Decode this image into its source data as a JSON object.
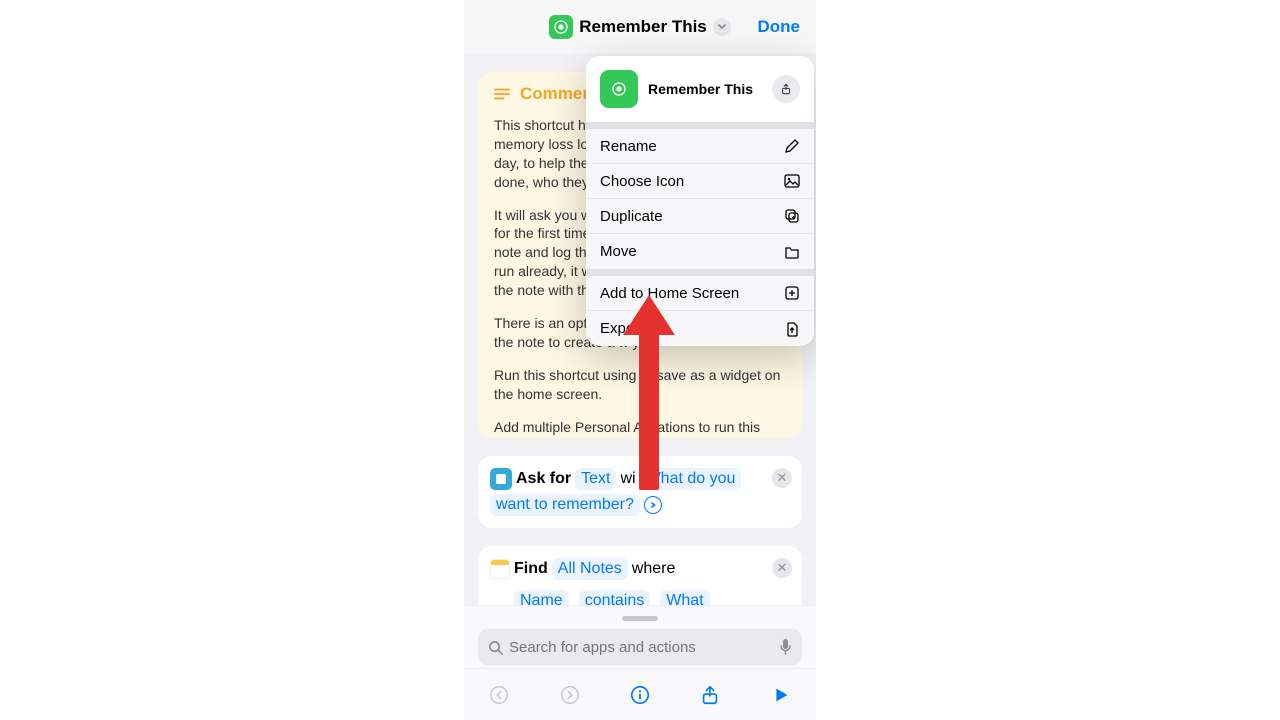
{
  "header": {
    "title": "Remember This",
    "done": "Done"
  },
  "comment": {
    "label": "Comment",
    "p1": "This shortcut he",
    "p1b": "memory loss log",
    "p1c": "day, to help the",
    "p1d": "done, who they",
    "p2": "It will ask you w",
    "p2b": "for the first time",
    "p2c": "note and log the",
    "p2d": "run already, it w",
    "p2e": "the note with th",
    "p3a": "There is an opti",
    "p3b": "the note to create a w             y.",
    "p4": "Run this shortcut using         or save as a widget on the home screen.",
    "p5": "Add multiple Personal A       mations to run this"
  },
  "ask": {
    "label": "Ask for",
    "type": "Text",
    "with": "wi",
    "prompt1": "What do you",
    "prompt2": "want to remember?"
  },
  "find": {
    "label": "Find",
    "target": "All Notes",
    "where": "where",
    "field": "Name",
    "op": "contains",
    "val": "What"
  },
  "search": {
    "placeholder": "Search for apps and actions"
  },
  "menu": {
    "title": "Remember This",
    "rename": "Rename",
    "chooseIcon": "Choose Icon",
    "duplicate": "Duplicate",
    "move": "Move",
    "addHome": "Add to Home Screen",
    "export": "Expo         e"
  }
}
